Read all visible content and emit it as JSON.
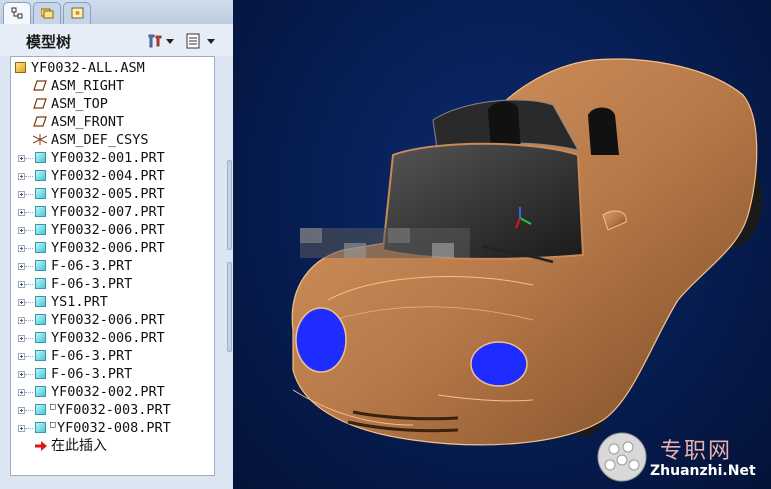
{
  "model_tree": {
    "title": "模型树",
    "tabs": [
      "model-tree-tab-icon",
      "folder-browser-tab-icon",
      "favorites-tab-icon"
    ],
    "tools": [
      "settings-tools-icon",
      "tree-show-icon"
    ],
    "root": "YF0032-ALL.ASM",
    "items": [
      {
        "label": "ASM_RIGHT",
        "icon": "datum-plane-icon",
        "expandable": false
      },
      {
        "label": "ASM_TOP",
        "icon": "datum-plane-icon",
        "expandable": false
      },
      {
        "label": "ASM_FRONT",
        "icon": "datum-plane-icon",
        "expandable": false
      },
      {
        "label": "ASM_DEF_CSYS",
        "icon": "coordinate-system-icon",
        "expandable": false
      },
      {
        "label": "YF0032-001.PRT",
        "icon": "part-icon",
        "expandable": true
      },
      {
        "label": "YF0032-004.PRT",
        "icon": "part-icon",
        "expandable": true
      },
      {
        "label": "YF0032-005.PRT",
        "icon": "part-icon",
        "expandable": true
      },
      {
        "label": "YF0032-007.PRT",
        "icon": "part-icon",
        "expandable": true
      },
      {
        "label": "YF0032-006.PRT",
        "icon": "part-icon",
        "expandable": true
      },
      {
        "label": "YF0032-006.PRT",
        "icon": "part-icon",
        "expandable": true
      },
      {
        "label": "F-06-3.PRT",
        "icon": "part-icon",
        "expandable": true
      },
      {
        "label": "F-06-3.PRT",
        "icon": "part-icon",
        "expandable": true
      },
      {
        "label": "YS1.PRT",
        "icon": "part-icon",
        "expandable": true
      },
      {
        "label": "YF0032-006.PRT",
        "icon": "part-icon",
        "expandable": true
      },
      {
        "label": "YF0032-006.PRT",
        "icon": "part-icon",
        "expandable": true
      },
      {
        "label": "F-06-3.PRT",
        "icon": "part-icon",
        "expandable": true
      },
      {
        "label": "F-06-3.PRT",
        "icon": "part-icon",
        "expandable": true
      },
      {
        "label": "YF0032-002.PRT",
        "icon": "part-icon",
        "expandable": true
      },
      {
        "label": "YF0032-003.PRT",
        "icon": "part-icon",
        "expandable": true,
        "marker": "□"
      },
      {
        "label": "YF0032-008.PRT",
        "icon": "part-icon",
        "expandable": true,
        "marker": "□"
      },
      {
        "label": "在此插入",
        "icon": "insert-here-arrow-icon",
        "expandable": false
      }
    ]
  },
  "viewport": {
    "background": "#061c4e",
    "model_color": "#b87a4a",
    "headlight_color": "#1f2cff"
  },
  "watermark": {
    "cn": "专职网",
    "en": "Zhuanzhi.Net"
  }
}
